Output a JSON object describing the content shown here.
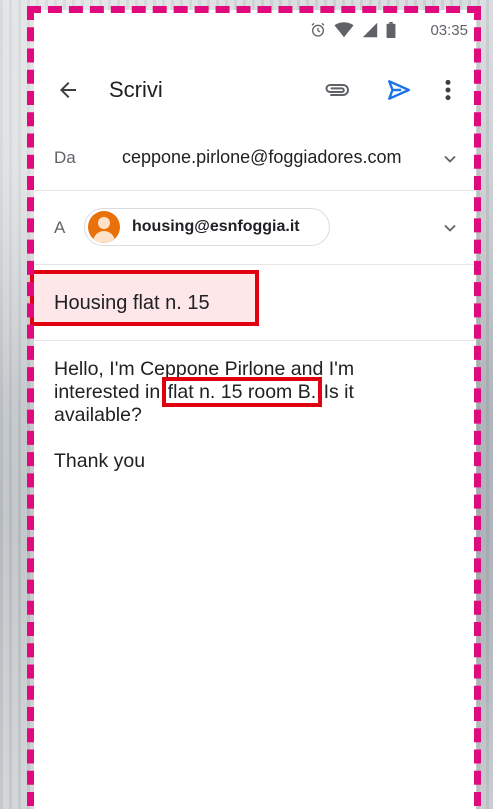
{
  "status_bar": {
    "time": "03:35",
    "icons": [
      "alarm-icon",
      "wifi-icon",
      "cell-signal-icon",
      "battery-icon"
    ]
  },
  "app_bar": {
    "title": "Scrivi",
    "icons": [
      "back-arrow-icon",
      "attachment-icon",
      "send-icon",
      "more-vert-icon"
    ]
  },
  "compose": {
    "from_label": "Da",
    "from_value": "ceppone.pirlone@foggiadores.com",
    "to_label": "A",
    "to_recipient": "housing@esnfoggia.it",
    "subject": "Housing flat n. 15",
    "body": {
      "line1_before": "Hello, I'm Ceppone Pirlone and I'm",
      "line2_before": "interested in",
      "highlight": "flat n. 15 room B.",
      "line2_after": "Is it",
      "line3": "available?",
      "closing": "Thank you"
    }
  },
  "colors": {
    "annotation_border": "#e0097e",
    "highlight_box": "#e00010",
    "send_icon": "#1a73e8",
    "avatar": "#e8710a"
  }
}
